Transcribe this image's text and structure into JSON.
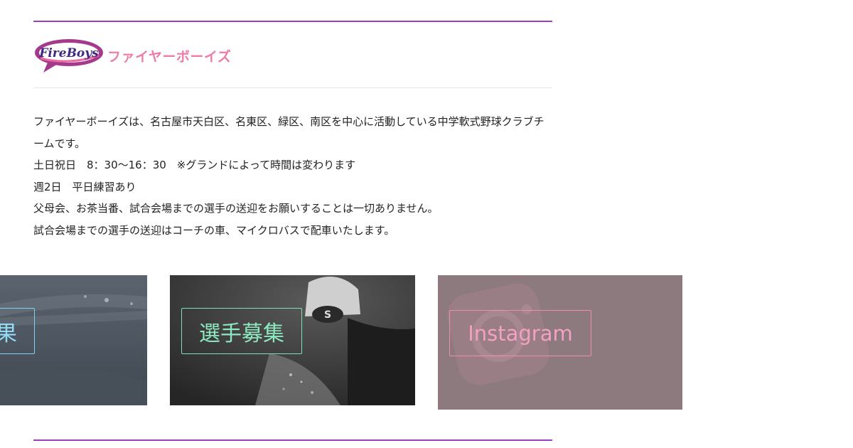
{
  "header": {
    "logo_badge_text": "FireBoys",
    "logo_katakana": "ファイヤーボーイズ"
  },
  "intro": {
    "lines": [
      "ファイヤーボーイズは、名古屋市天白区、名東区、緑区、南区を中心に活動している中学軟式野球クラブチームです。",
      "土日祝日　8：30〜16：30　※グランドによって時間は変わります",
      "週2日　平日練習あり",
      "父母会、お茶当番、試合会場までの選手の送迎をお願いすることは一切ありません。",
      "試合会場までの選手の送迎はコーチの車、マイクロバスで配車いたします。"
    ]
  },
  "cards": [
    {
      "label": "果",
      "name": "card-results",
      "accent": "#8fdcf4"
    },
    {
      "label": "選手募集",
      "name": "card-recruit",
      "accent": "#8ce8bf"
    },
    {
      "label": "Instagram",
      "name": "card-instagram",
      "accent": "#f3a0c3"
    }
  ],
  "colors": {
    "divider": "#9b3fbf",
    "brand_pink": "#ef7ba8"
  }
}
